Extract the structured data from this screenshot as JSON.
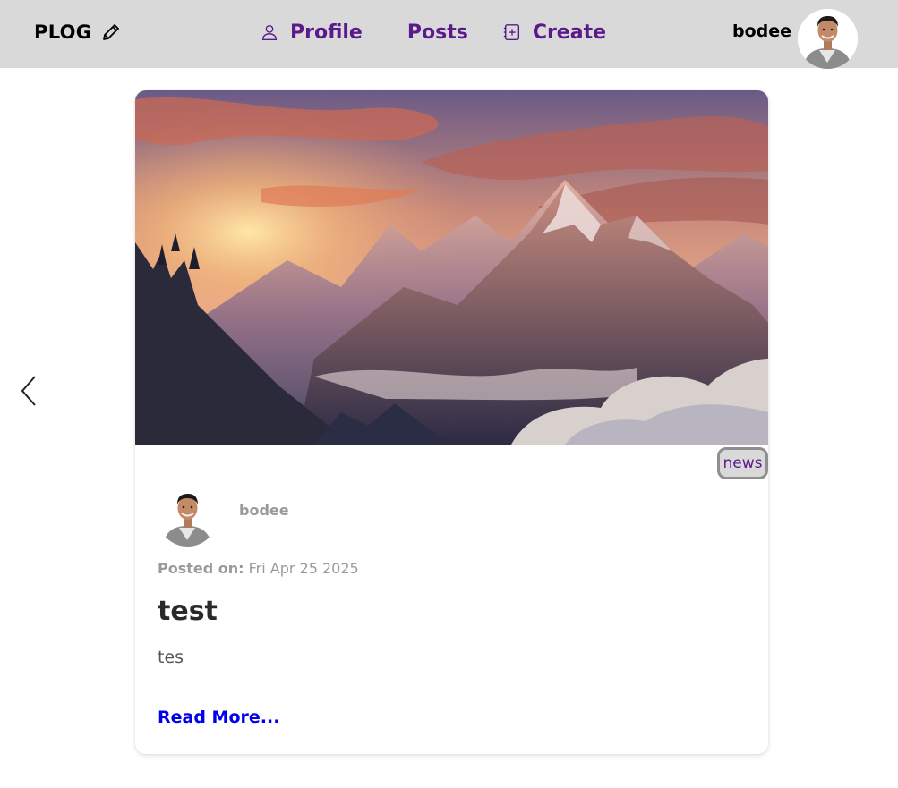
{
  "navbar": {
    "brand": "PLOG",
    "links": [
      {
        "label": "Profile",
        "icon": "user-icon"
      },
      {
        "label": "Posts"
      },
      {
        "label": "Create",
        "icon": "add-note-icon"
      }
    ],
    "username": "bodee"
  },
  "post": {
    "tag": "news",
    "author": "bodee",
    "posted_label": "Posted on:",
    "posted_date": "Fri Apr 25 2025",
    "title": "test",
    "body": "tes",
    "read_more": "Read More..."
  },
  "colors": {
    "navbar_bg": "#d9d9d9",
    "accent_purple": "#5b1a8c",
    "link_blue": "#0000ee",
    "muted_gray": "#9a9a9a"
  }
}
